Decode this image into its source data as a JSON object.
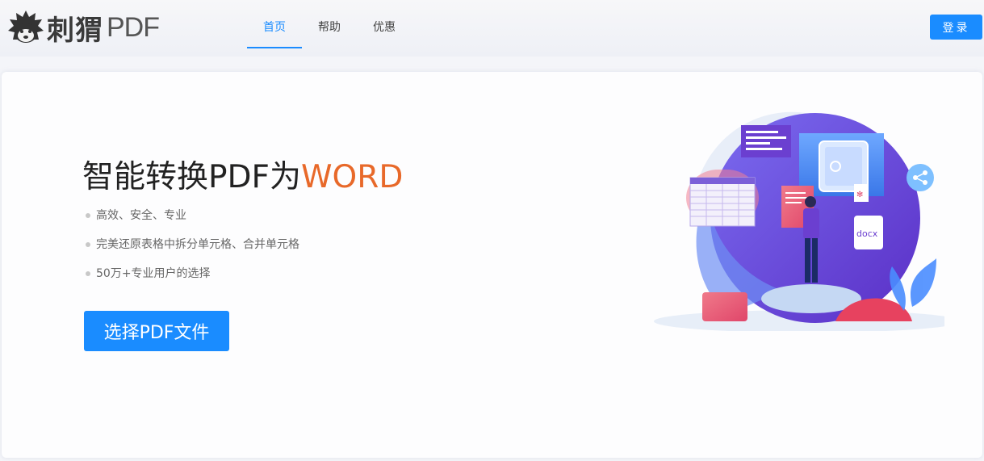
{
  "header": {
    "logo_cn": "刺猬",
    "logo_en": "PDF",
    "nav": [
      {
        "label": "首页",
        "active": true
      },
      {
        "label": "帮助",
        "active": false
      },
      {
        "label": "优惠",
        "active": false
      }
    ],
    "login_label": "登录"
  },
  "hero": {
    "title_main": "智能转换PDF为",
    "title_accent": "WORD",
    "features": [
      "高效、安全、专业",
      "完美还原表格中拆分单元格、合并单元格",
      "50万+专业用户的选择"
    ],
    "cta_label": "选择PDF文件",
    "illustration": {
      "doc_label": "docx",
      "icons": [
        "safe-icon",
        "share-icon",
        "spreadsheet-icon",
        "pdf-icon",
        "docx-file-icon"
      ]
    }
  },
  "colors": {
    "primary": "#1a8cff",
    "accent": "#e8692a",
    "purple": "#6b3fd0"
  }
}
